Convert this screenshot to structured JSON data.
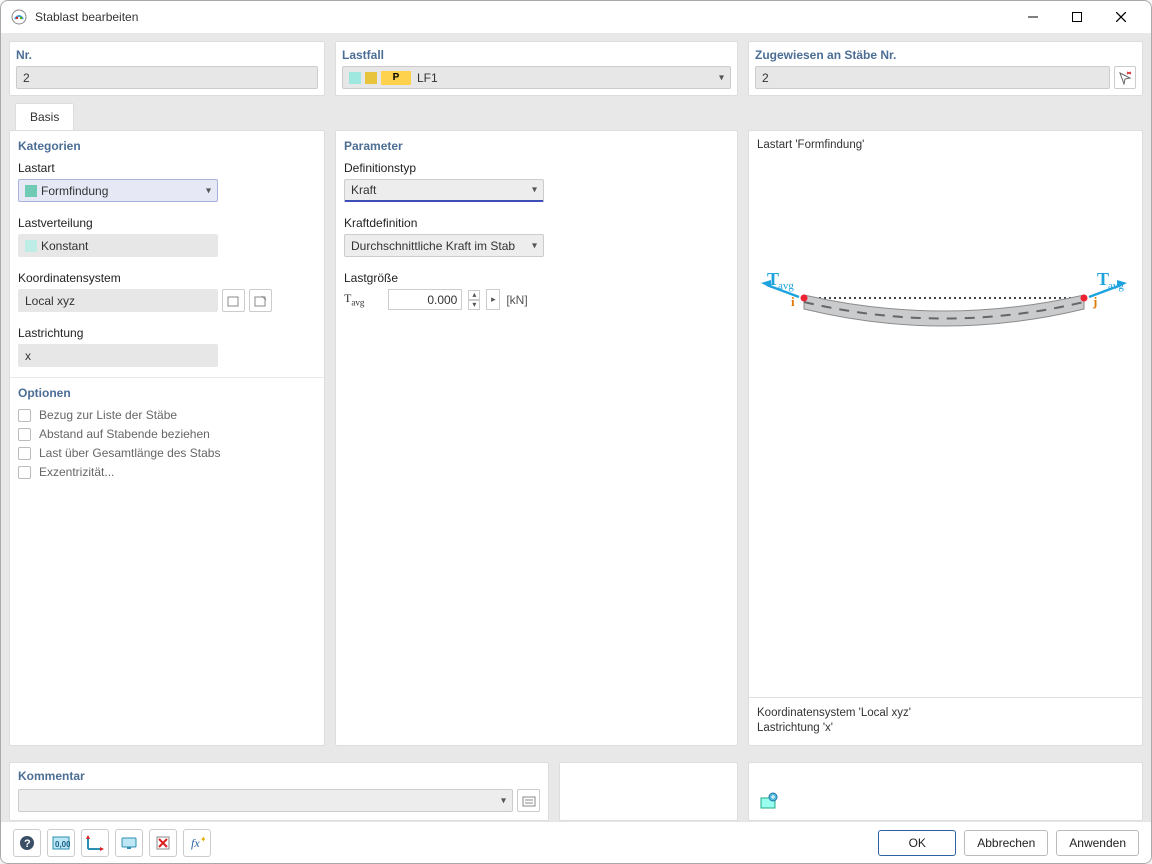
{
  "window": {
    "title": "Stablast bearbeiten"
  },
  "top": {
    "nr_label": "Nr.",
    "nr_value": "2",
    "lastfall_label": "Lastfall",
    "lastfall_value": "LF1",
    "lastfall_badge": "P",
    "assign_label": "Zugewiesen an Stäbe Nr.",
    "assign_value": "2"
  },
  "tabs": {
    "basis": "Basis"
  },
  "kategorien": {
    "title": "Kategorien",
    "lastart_label": "Lastart",
    "lastart_value": "Formfindung",
    "lastverteilung_label": "Lastverteilung",
    "lastverteilung_value": "Konstant",
    "koord_label": "Koordinatensystem",
    "koord_value": "Local xyz",
    "lastrichtung_label": "Lastrichtung",
    "lastrichtung_value": "x"
  },
  "optionen": {
    "title": "Optionen",
    "opt1": "Bezug zur Liste der Stäbe",
    "opt2": "Abstand auf Stabende beziehen",
    "opt3": "Last über Gesamtlänge des Stabs",
    "opt4": "Exzentrizität..."
  },
  "parameter": {
    "title": "Parameter",
    "def_label": "Definitionstyp",
    "def_value": "Kraft",
    "kraft_label": "Kraftdefinition",
    "kraft_value": "Durchschnittliche Kraft im Stab",
    "last_label": "Lastgröße",
    "t_sym": "T",
    "t_sub": "avg",
    "t_val": "0.000",
    "t_unit": "[kN]"
  },
  "preview": {
    "title": "Lastart 'Formfindung'",
    "tag_T": "T",
    "tag_avg": "avg",
    "node_i": "i",
    "node_j": "j",
    "info1": "Koordinatensystem 'Local xyz'",
    "info2": "Lastrichtung 'x'"
  },
  "kommentar": {
    "label": "Kommentar"
  },
  "footer": {
    "ok": "OK",
    "cancel": "Abbrechen",
    "apply": "Anwenden"
  }
}
